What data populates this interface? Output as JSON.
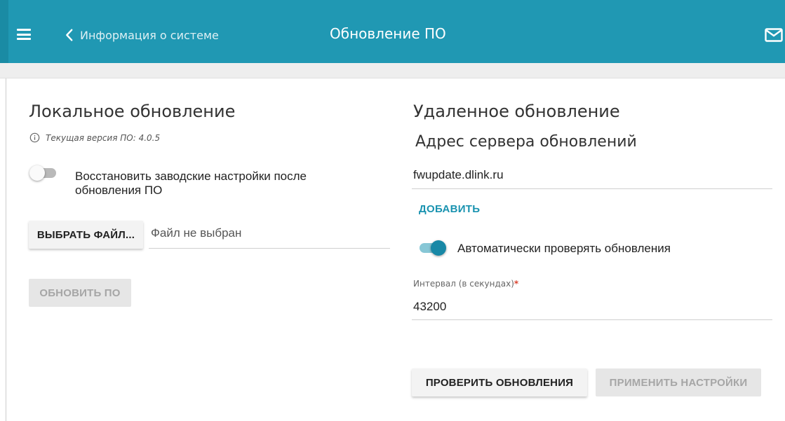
{
  "header": {
    "menu_icon": "hamburger-icon",
    "back_icon": "chevron-left-icon",
    "back_label": "Информация о системе",
    "title": "Обновление ПО",
    "mail_icon": "envelope-icon",
    "bar_color": "#2098b3"
  },
  "local": {
    "title": "Локальное обновление",
    "info_icon": "info-icon",
    "current_version": "Текущая версия ПО: 4.0.5",
    "reset_toggle": {
      "state": "off",
      "label_line1": "Восстановить заводские настройки после",
      "label_line2": "обновления ПО"
    },
    "choose_file_button": "ВЫБРАТЬ ФАЙЛ...",
    "file_status": "Файл не выбран",
    "update_button": "ОБНОВИТЬ ПО"
  },
  "remote": {
    "title": "Удаленное обновление",
    "server_title": "Адрес сервера обновлений",
    "server_value": "fwupdate.dlink.ru",
    "add_link": "ДОБАВИТЬ",
    "auto_check_toggle": {
      "state": "on",
      "label": "Автоматически проверять обновления"
    },
    "interval_caption": "Интервал (в секундах)",
    "interval_required_mark": "*",
    "interval_value": "43200",
    "check_button": "ПРОВЕРИТЬ ОБНОВЛЕНИЯ",
    "apply_button": "ПРИМЕНИТЬ НАСТРОЙКИ"
  },
  "colors": {
    "accent": "#1888a6",
    "required": "#d9432f"
  }
}
